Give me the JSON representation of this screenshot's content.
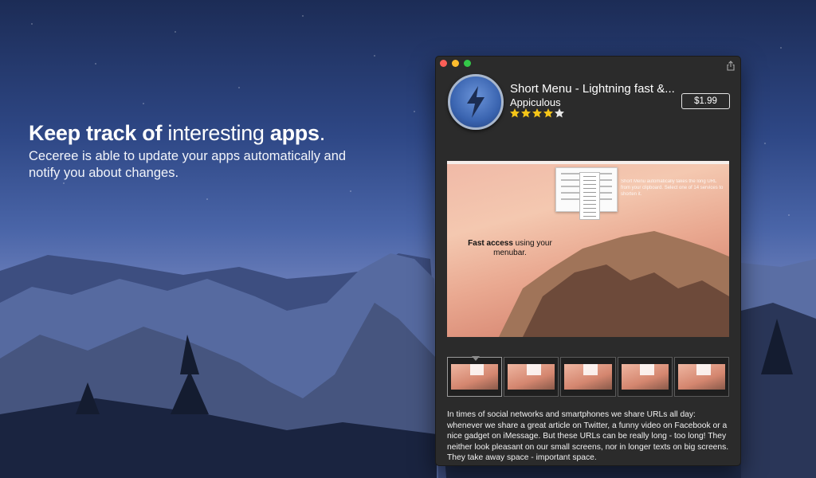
{
  "hero": {
    "headline_bold_1": "Keep track of",
    "headline_light": "interesting",
    "headline_bold_2": "apps",
    "headline_end": ".",
    "subline": "Ceceree is able to update your apps automatically and notify you about changes."
  },
  "window": {
    "app": {
      "title": "Short Menu - Lightning fast &...",
      "developer": "Appiculous",
      "rating": 4.5,
      "price_label": "$1.99",
      "icon": "lightning-bolt-icon"
    },
    "screenshot": {
      "bold_text": "Fast access",
      "text": "using your menubar.",
      "caption": "Short Menu automatically takes the long URL from your clipboard. Select one of 14 services to shorten it."
    },
    "thumbnails_count": 5,
    "description": "In times of social networks and smartphones we share URLs all day: whenever we share a great article on Twitter, a funny video on Facebook or a nice gadget on iMessage. But these URLs can be really long - too long! They neither look pleasant on our small screens, nor in longer texts on big screens. They take away space - important space."
  },
  "colors": {
    "window_bg": "#2b2b2b",
    "star": "#f5c518",
    "close": "#fc5f57",
    "minimize": "#fdbc2e",
    "maximize": "#33c748"
  }
}
